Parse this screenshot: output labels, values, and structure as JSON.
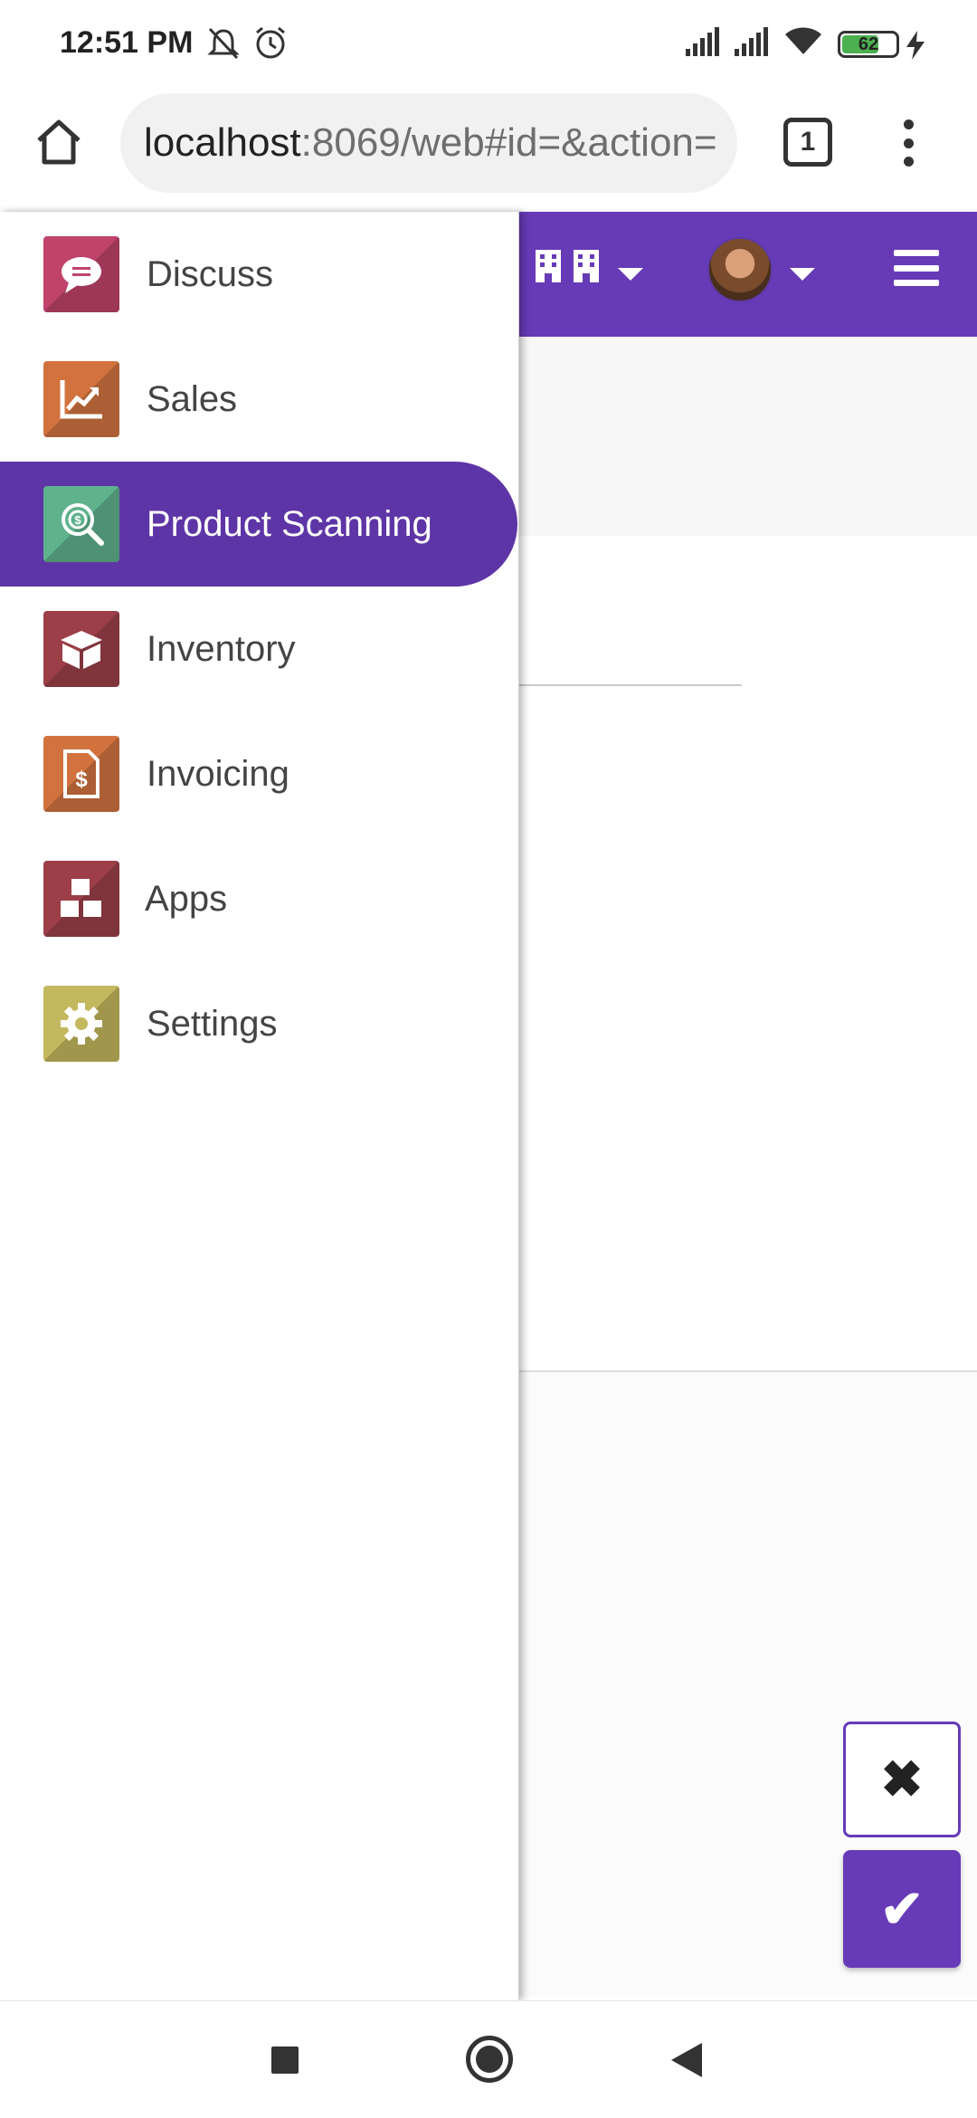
{
  "status_bar": {
    "time": "12:51 PM",
    "battery": "62",
    "icons": [
      "mute-icon",
      "alarm-icon",
      "signal-icon",
      "signal-icon",
      "wifi-icon",
      "battery-icon",
      "charging-icon"
    ]
  },
  "browser": {
    "url_host": "localhost",
    "url_path": ":8069/web#id=&action=",
    "tab_count": "1",
    "icons": [
      "home-icon",
      "tabs-icon",
      "more-vert-icon"
    ]
  },
  "app_bar": {
    "icons": [
      "company-switcher-icon",
      "user-avatar",
      "hamburger-menu-icon"
    ],
    "color": "#673ab7"
  },
  "drawer": {
    "items": [
      {
        "label": "Discuss",
        "icon": "discuss-icon",
        "color": "#c0436a",
        "active": false
      },
      {
        "label": "Sales",
        "icon": "sales-icon",
        "color": "#d2733f",
        "active": false
      },
      {
        "label": "Product Scanning",
        "icon": "product-scanning-icon",
        "color": "#5fb28c",
        "active": true
      },
      {
        "label": "Inventory",
        "icon": "inventory-icon",
        "color": "#9c3f48",
        "active": false
      },
      {
        "label": "Invoicing",
        "icon": "invoicing-icon",
        "color": "#d2733f",
        "active": false
      },
      {
        "label": "Apps",
        "icon": "apps-icon",
        "color": "#9c3f48",
        "active": false
      },
      {
        "label": "Settings",
        "icon": "settings-icon",
        "color": "#c3b85e",
        "active": false
      }
    ],
    "active_color": "#5e35a6"
  },
  "fab": {
    "close_glyph": "✖",
    "confirm_glyph": "✔"
  },
  "nav_bar": {
    "icons": [
      "recents-icon",
      "home-circle-icon",
      "back-icon"
    ]
  }
}
